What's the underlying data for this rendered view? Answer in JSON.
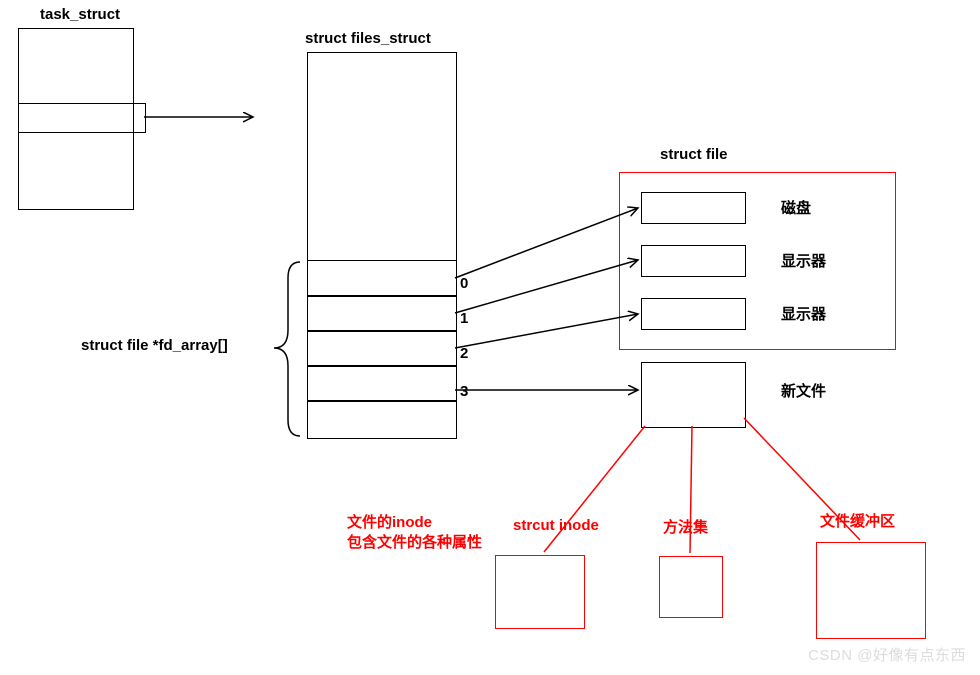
{
  "titles": {
    "task_struct": "task_struct",
    "files_struct": "struct files_struct",
    "struct_file": "struct file",
    "fd_array": "struct file *fd_array[]"
  },
  "fd_indices": {
    "i0": "0",
    "i1": "1",
    "i2": "2",
    "i3": "3"
  },
  "file_labels": {
    "disk": "磁盘",
    "display1": "显示器",
    "display2": "显示器",
    "newfile": "新文件"
  },
  "bottom_labels": {
    "inode_desc_l1": "文件的inode",
    "inode_desc_l2": "包含文件的各种属性",
    "strcut_inode": "strcut inode",
    "method_set": "方法集",
    "buffer": "文件缓冲区"
  },
  "watermark": "CSDN @好像有点东西"
}
